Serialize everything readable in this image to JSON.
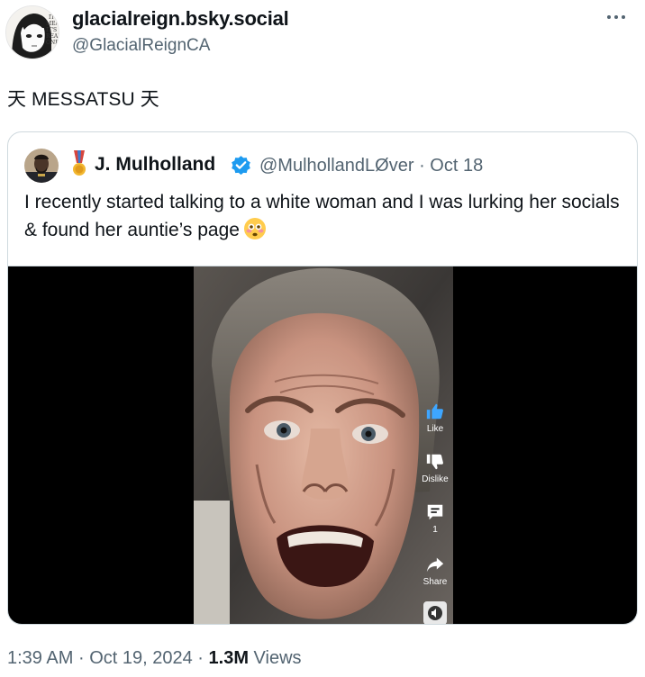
{
  "author": {
    "display_name": "glacialreign.bsky.social",
    "handle": "@GlacialReignCA",
    "avatar_icon": "anime-character-avatar"
  },
  "tweet_text": "天 MESSATSU 天",
  "quoted": {
    "display_name": "J. Mulholland",
    "handle": "@MulhollandLØver",
    "date": "Oct 18",
    "separator": "·",
    "verified_color": "#1d9bf0",
    "text": "I recently started talking to a white woman and I was lurking her socials & found her auntie’s page",
    "emoji_icon": "flushed-face-emoji",
    "video": {
      "actions": [
        {
          "label": "Like",
          "icon": "thumbs-up-icon"
        },
        {
          "label": "Dislike",
          "icon": "thumbs-down-icon"
        },
        {
          "label": "1",
          "icon": "comment-icon"
        },
        {
          "label": "Share",
          "icon": "share-arrow-icon"
        }
      ]
    }
  },
  "footer": {
    "time": "1:39 AM",
    "date": "Oct 19, 2024",
    "views_count": "1.3M",
    "views_label": "Views",
    "separator": "·"
  },
  "colors": {
    "text_primary": "#0f1419",
    "text_secondary": "#536471",
    "border": "#cfd9de"
  }
}
